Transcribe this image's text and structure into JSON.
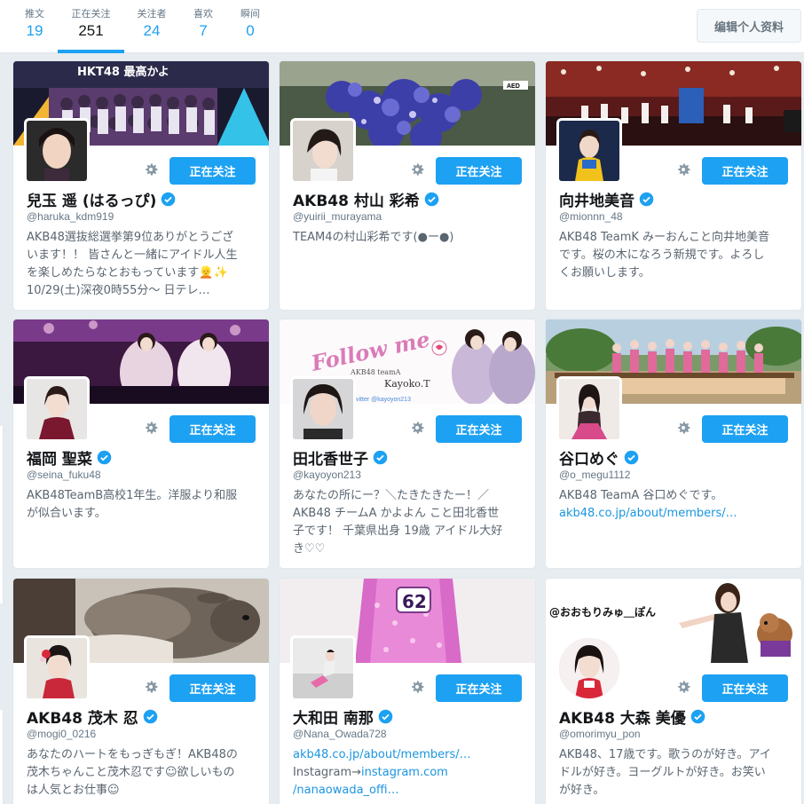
{
  "stats": [
    {
      "label": "推文",
      "value": "19"
    },
    {
      "label": "正在关注",
      "value": "251"
    },
    {
      "label": "关注者",
      "value": "24"
    },
    {
      "label": "喜欢",
      "value": "7"
    },
    {
      "label": "瞬间",
      "value": "0"
    }
  ],
  "edit_profile_label": "编辑个人资料",
  "colors": {
    "accent": "#1da1f2",
    "link": "#1b95e0",
    "muted": "#657786"
  },
  "cards": [
    {
      "banner_text": "HKT48 最高かよ",
      "name": "兒玉 遥 (はるっぴ)",
      "handle": "@haruka_kdm919",
      "follow_label": "正在关注",
      "bio": [
        "AKB48選抜総選挙第9位ありがとうござ",
        "います！！ 皆さんと一緒にアイドル人生",
        "を楽しめたらなとおもっています👱✨",
        "10/29(土)深夜0時55分〜 日テレ…"
      ]
    },
    {
      "banner_text": "AED",
      "name": "AKB48 村山 彩希",
      "handle": "@yuirii_murayama",
      "follow_label": "正在关注",
      "bio": [
        "TEAM4の村山彩希です(●ー●)"
      ]
    },
    {
      "name": "向井地美音",
      "handle": "@mionnn_48",
      "follow_label": "正在关注",
      "bio": [
        "AKB48 TeamK みーおんこと向井地美音",
        "です。桜の木になろう新規です。よろし",
        "くお願いします。"
      ]
    },
    {
      "name": "福岡 聖菜",
      "handle": "@seina_fuku48",
      "follow_label": "正在关注",
      "bio": [
        "AKB48TeamB高校1年生。洋服より和服",
        "が似合います。"
      ]
    },
    {
      "banner_text": "Follow me",
      "banner_sub1": "AKB48 teamA",
      "banner_sub2": "Kayoko.T",
      "banner_sub3": "vitter @kayoyon213",
      "name": "田北香世子",
      "handle": "@kayoyon213",
      "follow_label": "正在关注",
      "bio": [
        "あなたの所にー？＼たきたきたー！／",
        "AKB48 チームA かよよん こと田北香世",
        "子です！ 千葉県出身 19歳 アイドル大好",
        "き♡♡"
      ]
    },
    {
      "name": "谷口めぐ",
      "handle": "@o_megu1112",
      "follow_label": "正在关注",
      "bio": [
        "AKB48 TeamA 谷口めぐです。"
      ],
      "bio_link": "akb48.co.jp/about/members/…"
    },
    {
      "name": "AKB48 茂木 忍",
      "handle": "@mogi0_0216",
      "follow_label": "正在关注",
      "bio": [
        "あなたのハートをもっぎもぎ！AKB48の",
        "茂木ちゃんこと茂木忍です☺欲しいもの",
        "は人気とお仕事☺"
      ]
    },
    {
      "banner_text": "62",
      "name": "大和田 南那",
      "handle": "@Nana_Owada728",
      "follow_label": "正在关注",
      "bio_link": "akb48.co.jp/about/members/…",
      "bio_prefix": "Instagram→",
      "bio_link2": "instagram.com",
      "bio_link3": "/nanaowada_offi…"
    },
    {
      "banner_text": "@おおもりみゅ＿ぽん",
      "name": "AKB48 大森 美優",
      "handle": "@omorimyu_pon",
      "follow_label": "正在关注",
      "bio": [
        "AKB48、17歳です。歌うのが好き。アイ",
        "ドルが好き。ヨーグルトが好き。お笑い",
        "が好き。"
      ]
    }
  ]
}
